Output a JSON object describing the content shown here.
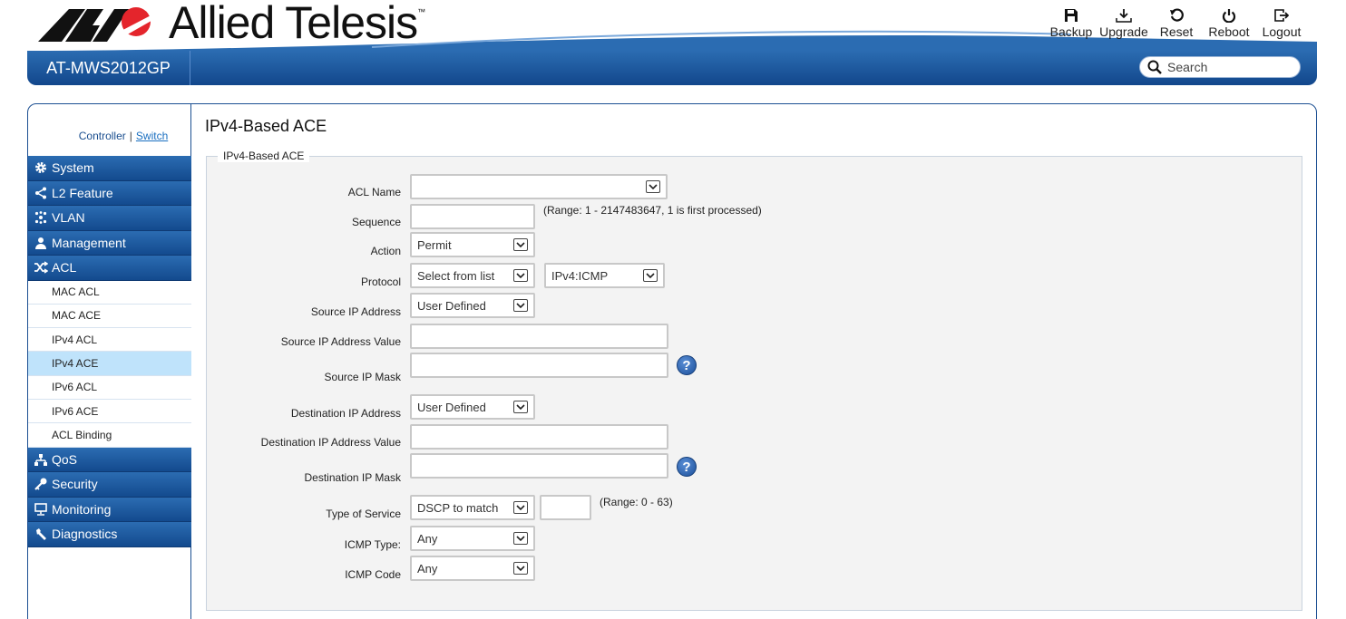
{
  "brand": {
    "name": "Allied Telesis",
    "tm": "™",
    "model": "AT-MWS2012GP"
  },
  "toolbar": [
    {
      "label": "Backup",
      "icon": "save-icon"
    },
    {
      "label": "Upgrade",
      "icon": "download-icon"
    },
    {
      "label": "Reset",
      "icon": "reset-icon"
    },
    {
      "label": "Reboot",
      "icon": "power-icon"
    },
    {
      "label": "Logout",
      "icon": "logout-icon"
    }
  ],
  "search": {
    "placeholder": "Search"
  },
  "switcher": {
    "controller": "Controller",
    "separator": "|",
    "switch": "Switch"
  },
  "menu": [
    {
      "label": "System",
      "icon": "gear-icon"
    },
    {
      "label": "L2 Feature",
      "icon": "share-icon"
    },
    {
      "label": "VLAN",
      "icon": "vlan-icon"
    },
    {
      "label": "Management",
      "icon": "user-icon"
    },
    {
      "label": "ACL",
      "icon": "shuffle-icon"
    }
  ],
  "acl_sub": [
    "MAC ACL",
    "MAC ACE",
    "IPv4 ACL",
    "IPv4 ACE",
    "IPv6 ACL",
    "IPv6 ACE",
    "ACL Binding"
  ],
  "menu_after": [
    {
      "label": "QoS",
      "icon": "qos-icon"
    },
    {
      "label": "Security",
      "icon": "key-icon"
    },
    {
      "label": "Monitoring",
      "icon": "monitor-icon"
    },
    {
      "label": "Diagnostics",
      "icon": "wrench-icon"
    }
  ],
  "page": {
    "title": "IPv4-Based ACE",
    "legend": "IPv4-Based ACE"
  },
  "form": {
    "acl_name": {
      "label": "ACL Name",
      "value": ""
    },
    "sequence": {
      "label": "Sequence",
      "value": "",
      "hint": "(Range: 1 - 2147483647, 1 is first processed)"
    },
    "action": {
      "label": "Action",
      "value": "Permit"
    },
    "protocol": {
      "label": "Protocol",
      "value": "Select from list",
      "value2": "IPv4:ICMP"
    },
    "src_ip": {
      "label": "Source IP Address",
      "value": "User Defined"
    },
    "src_ip_value": {
      "label": "Source IP Address Value",
      "value": ""
    },
    "src_ip_mask": {
      "label": "Source IP Mask",
      "value": ""
    },
    "dst_ip": {
      "label": "Destination IP Address",
      "value": "User Defined"
    },
    "dst_ip_value": {
      "label": "Destination IP Address Value",
      "value": ""
    },
    "dst_ip_mask": {
      "label": "Destination IP Mask",
      "value": ""
    },
    "tos": {
      "label": "Type of Service",
      "value": "DSCP to match",
      "value2": "",
      "hint": "(Range: 0 - 63)"
    },
    "icmp_type": {
      "label": "ICMP Type:",
      "value": "Any"
    },
    "icmp_code": {
      "label": "ICMP Code",
      "value": "Any"
    }
  },
  "colors": {
    "nav": "#1f5ea6",
    "selected": "#bfe3fb",
    "border": "#1c4f92"
  }
}
